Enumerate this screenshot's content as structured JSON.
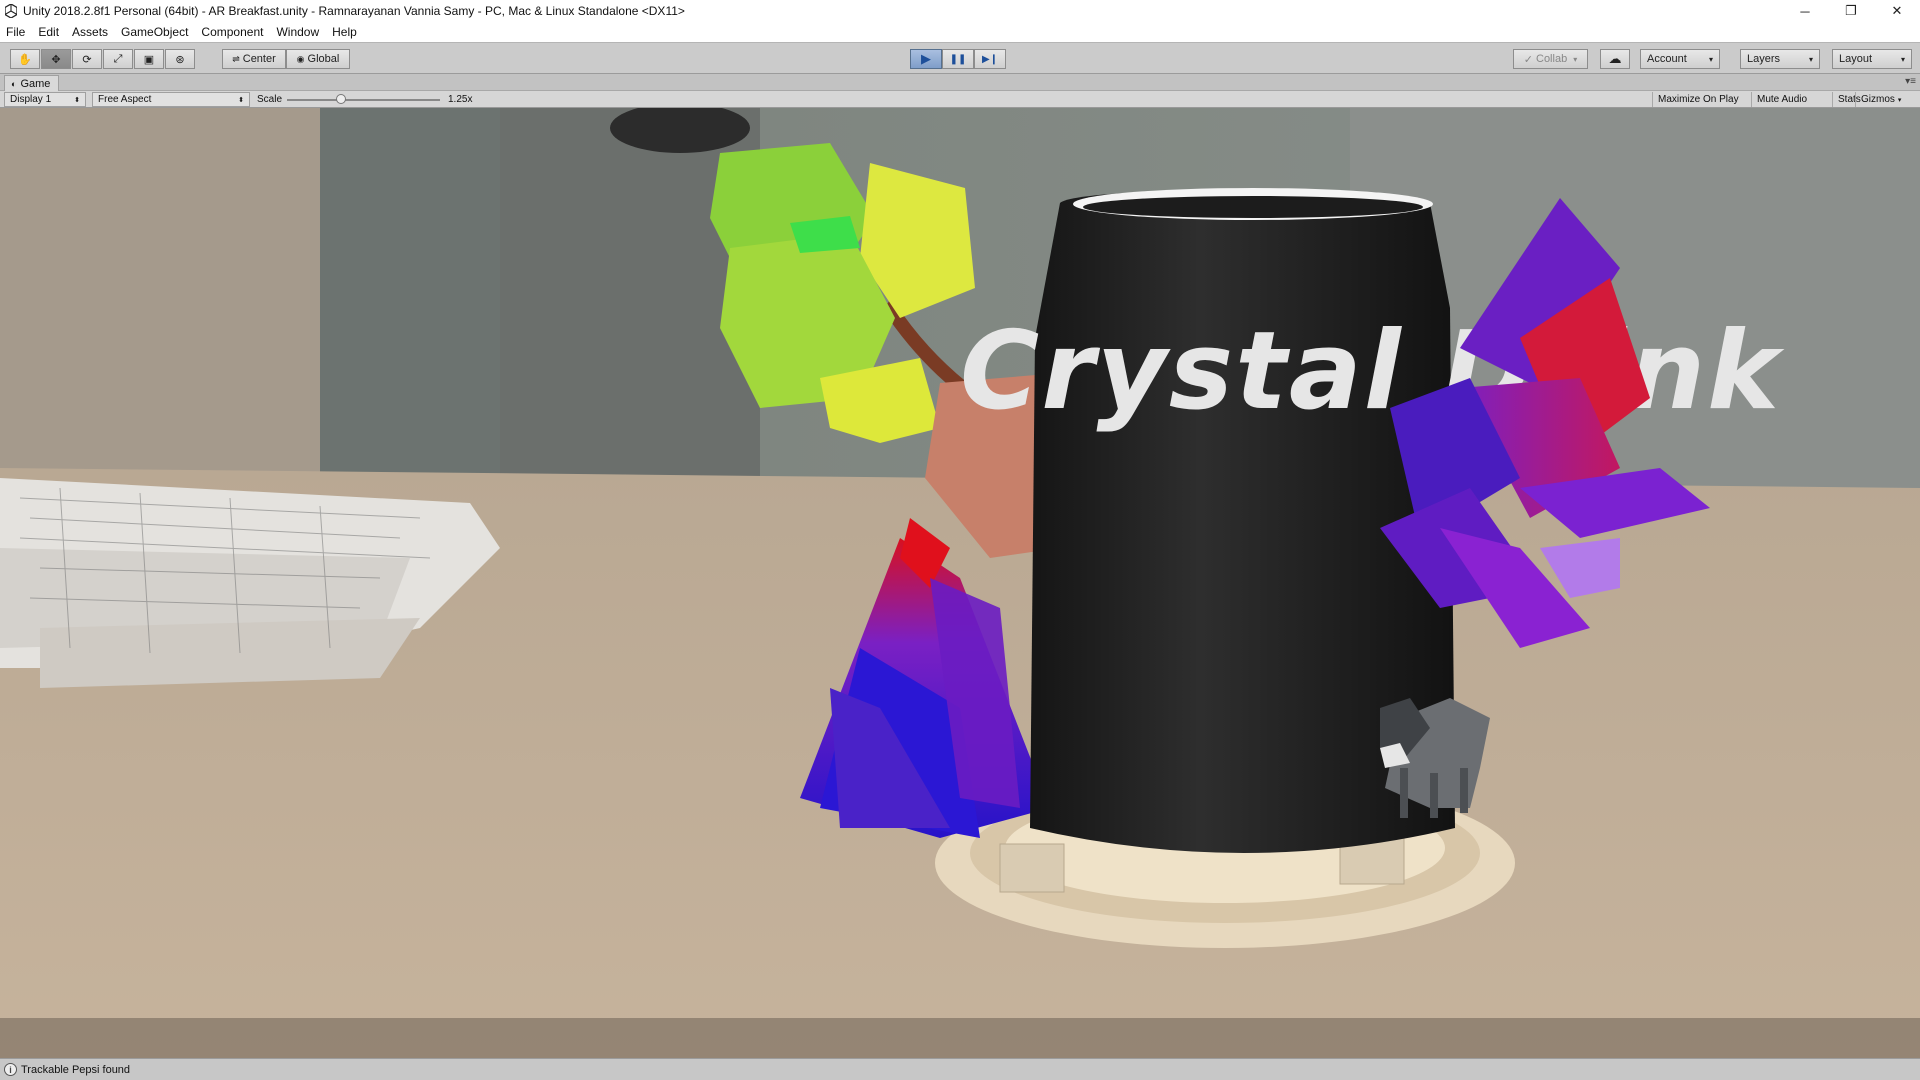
{
  "window": {
    "title": "Unity 2018.2.8f1 Personal (64bit) - AR Breakfast.unity - Ramnarayanan Vannia Samy - PC, Mac & Linux Standalone <DX11>",
    "minimize_glyph": "─",
    "restore_glyph": "❐",
    "close_glyph": "✕"
  },
  "menu": [
    "File",
    "Edit",
    "Assets",
    "GameObject",
    "Component",
    "Window",
    "Help"
  ],
  "toolbar": {
    "tools": [
      {
        "name": "hand-tool",
        "icon": "hand-icon",
        "glyph": "✋"
      },
      {
        "name": "move-tool",
        "icon": "move-icon",
        "glyph": "✥"
      },
      {
        "name": "rotate-tool",
        "icon": "rotate-icon",
        "glyph": "⟳"
      },
      {
        "name": "scale-tool",
        "icon": "scale-icon",
        "glyph": "⤢"
      },
      {
        "name": "rect-tool",
        "icon": "rect-icon",
        "glyph": "▣"
      },
      {
        "name": "transform-tool",
        "icon": "transform-icon",
        "glyph": "⊛"
      }
    ],
    "pivot_label": "Center",
    "space_label": "Global",
    "play_glyph": "▶",
    "pause_glyph": "❚❚",
    "step_glyph": "▶❙",
    "collab_label": "Collab",
    "account_label": "Account",
    "layers_label": "Layers",
    "layout_label": "Layout",
    "dropdown_glyph": "▾"
  },
  "game_tab": {
    "label": "Game",
    "menu_glyph": "▾≡"
  },
  "game_bar": {
    "display_label": "Display 1",
    "aspect_label": "Free Aspect",
    "scale_label": "Scale",
    "scale_value": "1.25",
    "scale_fraction": 0.35,
    "right_buttons": [
      "Maximize On Play",
      "Mute Audio",
      "Stats",
      "Gizmos"
    ]
  },
  "scene": {
    "can_label": "Crystal Drink"
  },
  "status": {
    "message": "Trackable Pepsi found"
  }
}
